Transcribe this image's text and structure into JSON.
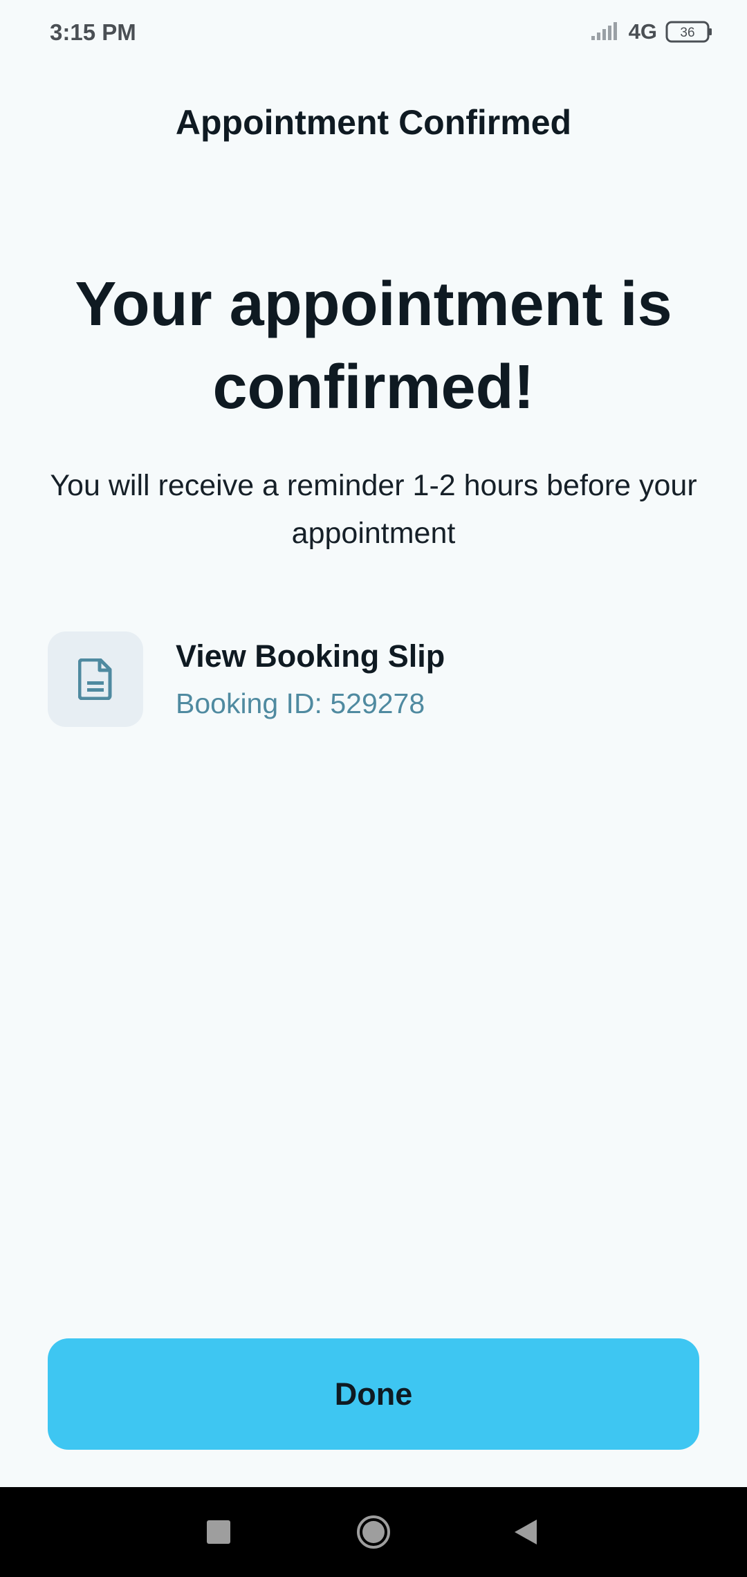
{
  "status_bar": {
    "time": "3:15 PM",
    "network": "4G",
    "battery": "36",
    "icons": [
      "signal-icon",
      "battery-icon"
    ]
  },
  "header": {
    "title": "Appointment Confirmed"
  },
  "main": {
    "headline": "Your appointment is confirmed!",
    "subtext": "You will receive a reminder 1-2 hours before your appointment",
    "booking_slip": {
      "icon": "document-icon",
      "title": "View Booking Slip",
      "subtitle": "Booking ID: 529278"
    }
  },
  "actions": {
    "done_label": "Done"
  },
  "nav_bar": {
    "icons": [
      "recents-icon",
      "home-icon",
      "back-icon"
    ]
  },
  "colors": {
    "background": "#f6fafb",
    "accent": "#3ec6f2",
    "icon_tint": "#4f8aa0",
    "text_primary": "#0f1a22"
  }
}
